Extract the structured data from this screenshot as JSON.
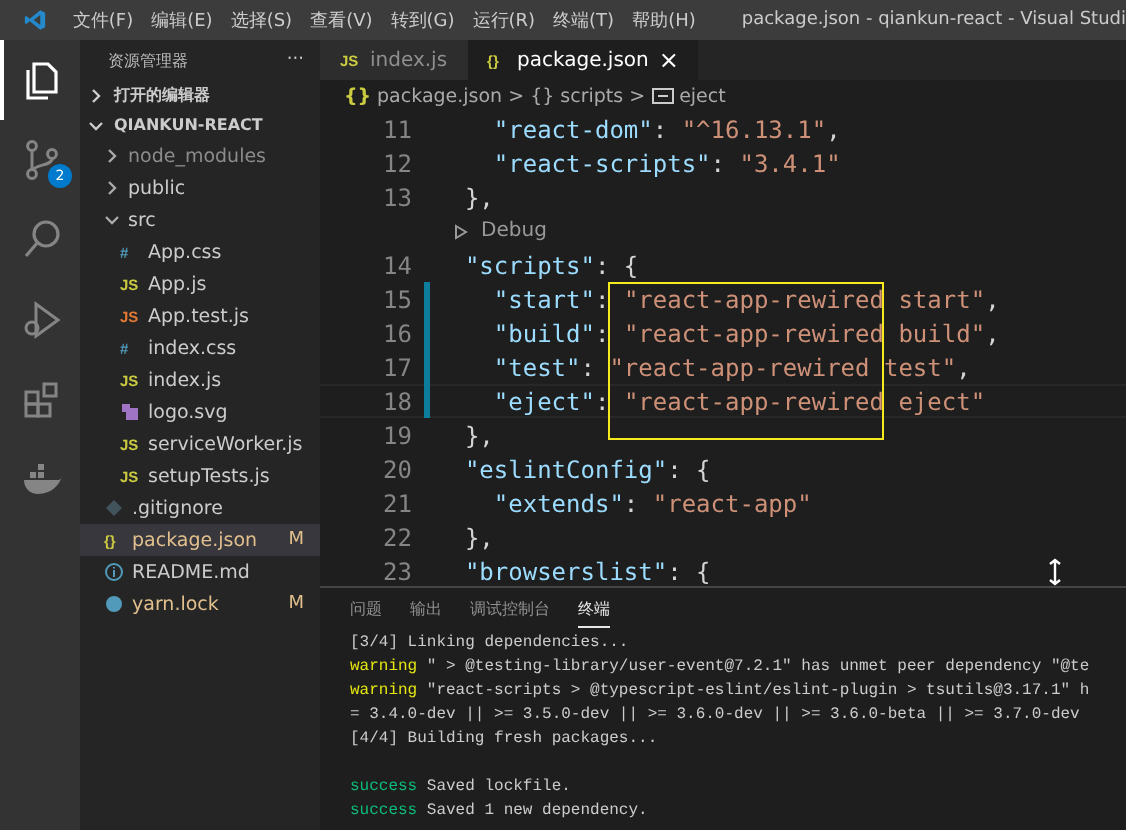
{
  "menu_bar": {
    "menus": [
      "文件(F)",
      "编辑(E)",
      "选择(S)",
      "查看(V)",
      "转到(G)",
      "运行(R)",
      "终端(T)",
      "帮助(H)"
    ],
    "title": "package.json - qiankun-react - Visual Studi"
  },
  "activity_bar": [
    {
      "kind": "files",
      "selected": true
    },
    {
      "kind": "source-control",
      "selected": false,
      "badge": "2"
    },
    {
      "kind": "search",
      "selected": false
    },
    {
      "kind": "run",
      "selected": false
    },
    {
      "kind": "extensions",
      "selected": false
    },
    {
      "kind": "docker",
      "selected": false
    }
  ],
  "sidebar": {
    "title": "资源管理器",
    "more": "···",
    "sections": [
      {
        "label": "打开的编辑器",
        "expanded": false
      },
      {
        "label": "QIANKUN-REACT",
        "expanded": true
      }
    ],
    "items": [
      {
        "name": "node_modules",
        "kind": "folder",
        "expanded": false,
        "ignored": true,
        "selected": false
      },
      {
        "name": "public",
        "kind": "folder",
        "expanded": false,
        "ignored": false,
        "selected": false
      },
      {
        "name": "src",
        "kind": "folder",
        "expanded": true,
        "ignored": false,
        "selected": false,
        "children": [
          {
            "name": "App.css",
            "kind": "css",
            "glyph": "#",
            "selected": false
          },
          {
            "name": "App.js",
            "kind": "js",
            "glyph": "JS",
            "selected": false
          },
          {
            "name": "App.test.js",
            "kind": "test",
            "glyph": "JS",
            "selected": false
          },
          {
            "name": "index.css",
            "kind": "css",
            "glyph": "#",
            "selected": false
          },
          {
            "name": "index.js",
            "kind": "js",
            "glyph": "JS",
            "selected": false
          },
          {
            "name": "logo.svg",
            "kind": "svg",
            "selected": false
          },
          {
            "name": "serviceWorker.js",
            "kind": "js",
            "glyph": "JS",
            "selected": false
          },
          {
            "name": "setupTests.js",
            "kind": "js",
            "glyph": "JS",
            "selected": false
          }
        ]
      },
      {
        "name": ".gitignore",
        "kind": "git",
        "selected": false
      },
      {
        "name": "package.json",
        "kind": "json",
        "glyph": "{}",
        "git": "M",
        "selected": true
      },
      {
        "name": "README.md",
        "kind": "info",
        "selected": false
      },
      {
        "name": "yarn.lock",
        "kind": "yarn",
        "git": "M",
        "selected": false
      }
    ]
  },
  "tabs": [
    {
      "label": "index.js",
      "glyph": "JS",
      "selected": false
    },
    {
      "label": "package.json",
      "glyph": "{}",
      "selected": true,
      "close": "×"
    }
  ],
  "breadcrumbs": [
    {
      "glyph": "{}",
      "label": "package.json",
      "kind": "file"
    },
    {
      "glyph": "{}",
      "label": "scripts",
      "kind": "object"
    },
    {
      "label": "eject",
      "kind": "property"
    }
  ],
  "breadcrumb_separator": ">",
  "code": [
    {
      "number": "11",
      "kind": "code",
      "modified": false,
      "tokens": [
        {
          "kind": "key",
          "text": "    \"react-dom\""
        },
        {
          "kind": "punct",
          "text": ": "
        },
        {
          "kind": "string",
          "text": "\"^16.13.1\""
        },
        {
          "kind": "punct",
          "text": ","
        }
      ]
    },
    {
      "number": "12",
      "kind": "code",
      "modified": false,
      "tokens": [
        {
          "kind": "key",
          "text": "    \"react-scripts\""
        },
        {
          "kind": "punct",
          "text": ": "
        },
        {
          "kind": "string",
          "text": "\"3.4.1\""
        }
      ]
    },
    {
      "number": "13",
      "kind": "code",
      "modified": false,
      "tokens": [
        {
          "kind": "punct",
          "text": "  },"
        }
      ]
    },
    {
      "kind": "codelens",
      "text": "Debug"
    },
    {
      "number": "14",
      "kind": "code",
      "modified": false,
      "tokens": [
        {
          "kind": "key",
          "text": "  \"scripts\""
        },
        {
          "kind": "punct",
          "text": ": {"
        }
      ]
    },
    {
      "number": "15",
      "kind": "code",
      "modified": true,
      "tokens": [
        {
          "kind": "key",
          "text": "    \"start\""
        },
        {
          "kind": "punct",
          "text": ": "
        },
        {
          "kind": "string",
          "text": "\"react-app-rewired start\""
        },
        {
          "kind": "punct",
          "text": ","
        }
      ]
    },
    {
      "number": "16",
      "kind": "code",
      "modified": true,
      "tokens": [
        {
          "kind": "key",
          "text": "    \"build\""
        },
        {
          "kind": "punct",
          "text": ": "
        },
        {
          "kind": "string",
          "text": "\"react-app-rewired build\""
        },
        {
          "kind": "punct",
          "text": ","
        }
      ]
    },
    {
      "number": "17",
      "kind": "code",
      "modified": true,
      "tokens": [
        {
          "kind": "key",
          "text": "    \"test\""
        },
        {
          "kind": "punct",
          "text": ": "
        },
        {
          "kind": "string",
          "text": "\"react-app-rewired test\""
        },
        {
          "kind": "punct",
          "text": ","
        }
      ]
    },
    {
      "number": "18",
      "kind": "code",
      "modified": true,
      "tokens": [
        {
          "kind": "key",
          "text": "    \"eject\""
        },
        {
          "kind": "punct",
          "text": ": "
        },
        {
          "kind": "string",
          "text": "\"react-app-rewired eject\""
        }
      ]
    },
    {
      "number": "19",
      "kind": "code",
      "modified": false,
      "tokens": [
        {
          "kind": "punct",
          "text": "  },"
        }
      ]
    },
    {
      "number": "20",
      "kind": "code",
      "modified": false,
      "tokens": [
        {
          "kind": "key",
          "text": "  \"eslintConfig\""
        },
        {
          "kind": "punct",
          "text": ": {"
        }
      ]
    },
    {
      "number": "21",
      "kind": "code",
      "modified": false,
      "tokens": [
        {
          "kind": "key",
          "text": "    \"extends\""
        },
        {
          "kind": "punct",
          "text": ": "
        },
        {
          "kind": "string",
          "text": "\"react-app\""
        }
      ]
    },
    {
      "number": "22",
      "kind": "code",
      "modified": false,
      "tokens": [
        {
          "kind": "punct",
          "text": "  },"
        }
      ]
    },
    {
      "number": "23",
      "kind": "code",
      "modified": false,
      "tokens": [
        {
          "kind": "key",
          "text": "  \"browserslist\""
        },
        {
          "kind": "punct",
          "text": ": {"
        }
      ]
    }
  ],
  "panel": {
    "tabs": [
      {
        "label": "问题",
        "selected": false
      },
      {
        "label": "输出",
        "selected": false
      },
      {
        "label": "调试控制台",
        "selected": false
      },
      {
        "label": "终端",
        "selected": true
      }
    ],
    "terminal": [
      {
        "text": "[3/4] Linking dependencies..."
      },
      {
        "prefix": "warning",
        "kind": "warning",
        "text": "\" > @testing-library/user-event@7.2.1\" has unmet peer dependency \"@te"
      },
      {
        "prefix": "warning",
        "kind": "warning",
        "text": "\"react-scripts > @typescript-eslint/eslint-plugin > tsutils@3.17.1\" h"
      },
      {
        "text": "= 3.4.0-dev || >= 3.5.0-dev || >= 3.6.0-dev || >= 3.6.0-beta || >= 3.7.0-dev"
      },
      {
        "text": "[4/4] Building fresh packages..."
      },
      {
        "blank": true
      },
      {
        "prefix": "success",
        "kind": "success",
        "text": "Saved lockfile."
      },
      {
        "prefix": "success",
        "kind": "success",
        "text": "Saved 1 new dependency."
      }
    ]
  }
}
